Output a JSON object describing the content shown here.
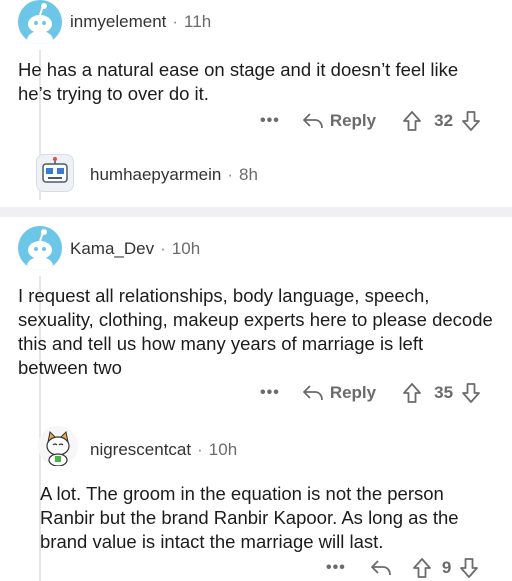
{
  "comments": [
    {
      "username": "inmyelement",
      "time": "11h",
      "text": "He has a natural ease on stage and it doesn’t feel like he’s trying to over do it.",
      "more": "•••",
      "reply_label": "Reply",
      "votes": "32"
    },
    {
      "username": "humhaepyarmein",
      "time": "8h"
    },
    {
      "username": "Kama_Dev",
      "time": "10h",
      "text": "I request all relationships, body language, speech, sexuality, clothing, makeup experts here to please decode this and tell us how many years of marriage is left between two",
      "more": "•••",
      "reply_label": "Reply",
      "votes": "35"
    },
    {
      "username": "nigrescentcat",
      "time": "10h",
      "text": "A lot. The groom in the equation is not the person Ranbir but the brand Ranbir Kapoor. As long as the brand value is intact the marriage will last.",
      "more": "•••",
      "votes": "9"
    }
  ],
  "separator": "·",
  "colors": {
    "avatar_bg": "#6cc6e8",
    "divider": "#f0f0f2",
    "meta": "#6b6b6b"
  }
}
